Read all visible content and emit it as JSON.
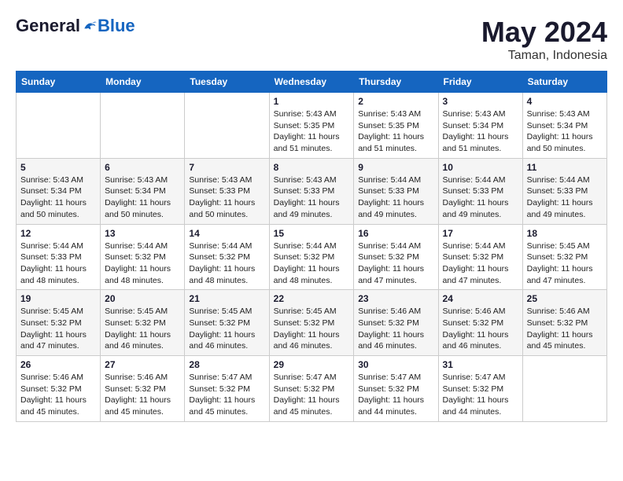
{
  "logo": {
    "general": "General",
    "blue": "Blue"
  },
  "header": {
    "month": "May 2024",
    "location": "Taman, Indonesia"
  },
  "weekdays": [
    "Sunday",
    "Monday",
    "Tuesday",
    "Wednesday",
    "Thursday",
    "Friday",
    "Saturday"
  ],
  "weeks": [
    [
      {
        "day": "",
        "sunrise": "",
        "sunset": "",
        "daylight": ""
      },
      {
        "day": "",
        "sunrise": "",
        "sunset": "",
        "daylight": ""
      },
      {
        "day": "",
        "sunrise": "",
        "sunset": "",
        "daylight": ""
      },
      {
        "day": "1",
        "sunrise": "Sunrise: 5:43 AM",
        "sunset": "Sunset: 5:35 PM",
        "daylight": "Daylight: 11 hours and 51 minutes."
      },
      {
        "day": "2",
        "sunrise": "Sunrise: 5:43 AM",
        "sunset": "Sunset: 5:35 PM",
        "daylight": "Daylight: 11 hours and 51 minutes."
      },
      {
        "day": "3",
        "sunrise": "Sunrise: 5:43 AM",
        "sunset": "Sunset: 5:34 PM",
        "daylight": "Daylight: 11 hours and 51 minutes."
      },
      {
        "day": "4",
        "sunrise": "Sunrise: 5:43 AM",
        "sunset": "Sunset: 5:34 PM",
        "daylight": "Daylight: 11 hours and 50 minutes."
      }
    ],
    [
      {
        "day": "5",
        "sunrise": "Sunrise: 5:43 AM",
        "sunset": "Sunset: 5:34 PM",
        "daylight": "Daylight: 11 hours and 50 minutes."
      },
      {
        "day": "6",
        "sunrise": "Sunrise: 5:43 AM",
        "sunset": "Sunset: 5:34 PM",
        "daylight": "Daylight: 11 hours and 50 minutes."
      },
      {
        "day": "7",
        "sunrise": "Sunrise: 5:43 AM",
        "sunset": "Sunset: 5:33 PM",
        "daylight": "Daylight: 11 hours and 50 minutes."
      },
      {
        "day": "8",
        "sunrise": "Sunrise: 5:43 AM",
        "sunset": "Sunset: 5:33 PM",
        "daylight": "Daylight: 11 hours and 49 minutes."
      },
      {
        "day": "9",
        "sunrise": "Sunrise: 5:44 AM",
        "sunset": "Sunset: 5:33 PM",
        "daylight": "Daylight: 11 hours and 49 minutes."
      },
      {
        "day": "10",
        "sunrise": "Sunrise: 5:44 AM",
        "sunset": "Sunset: 5:33 PM",
        "daylight": "Daylight: 11 hours and 49 minutes."
      },
      {
        "day": "11",
        "sunrise": "Sunrise: 5:44 AM",
        "sunset": "Sunset: 5:33 PM",
        "daylight": "Daylight: 11 hours and 49 minutes."
      }
    ],
    [
      {
        "day": "12",
        "sunrise": "Sunrise: 5:44 AM",
        "sunset": "Sunset: 5:33 PM",
        "daylight": "Daylight: 11 hours and 48 minutes."
      },
      {
        "day": "13",
        "sunrise": "Sunrise: 5:44 AM",
        "sunset": "Sunset: 5:32 PM",
        "daylight": "Daylight: 11 hours and 48 minutes."
      },
      {
        "day": "14",
        "sunrise": "Sunrise: 5:44 AM",
        "sunset": "Sunset: 5:32 PM",
        "daylight": "Daylight: 11 hours and 48 minutes."
      },
      {
        "day": "15",
        "sunrise": "Sunrise: 5:44 AM",
        "sunset": "Sunset: 5:32 PM",
        "daylight": "Daylight: 11 hours and 48 minutes."
      },
      {
        "day": "16",
        "sunrise": "Sunrise: 5:44 AM",
        "sunset": "Sunset: 5:32 PM",
        "daylight": "Daylight: 11 hours and 47 minutes."
      },
      {
        "day": "17",
        "sunrise": "Sunrise: 5:44 AM",
        "sunset": "Sunset: 5:32 PM",
        "daylight": "Daylight: 11 hours and 47 minutes."
      },
      {
        "day": "18",
        "sunrise": "Sunrise: 5:45 AM",
        "sunset": "Sunset: 5:32 PM",
        "daylight": "Daylight: 11 hours and 47 minutes."
      }
    ],
    [
      {
        "day": "19",
        "sunrise": "Sunrise: 5:45 AM",
        "sunset": "Sunset: 5:32 PM",
        "daylight": "Daylight: 11 hours and 47 minutes."
      },
      {
        "day": "20",
        "sunrise": "Sunrise: 5:45 AM",
        "sunset": "Sunset: 5:32 PM",
        "daylight": "Daylight: 11 hours and 46 minutes."
      },
      {
        "day": "21",
        "sunrise": "Sunrise: 5:45 AM",
        "sunset": "Sunset: 5:32 PM",
        "daylight": "Daylight: 11 hours and 46 minutes."
      },
      {
        "day": "22",
        "sunrise": "Sunrise: 5:45 AM",
        "sunset": "Sunset: 5:32 PM",
        "daylight": "Daylight: 11 hours and 46 minutes."
      },
      {
        "day": "23",
        "sunrise": "Sunrise: 5:46 AM",
        "sunset": "Sunset: 5:32 PM",
        "daylight": "Daylight: 11 hours and 46 minutes."
      },
      {
        "day": "24",
        "sunrise": "Sunrise: 5:46 AM",
        "sunset": "Sunset: 5:32 PM",
        "daylight": "Daylight: 11 hours and 46 minutes."
      },
      {
        "day": "25",
        "sunrise": "Sunrise: 5:46 AM",
        "sunset": "Sunset: 5:32 PM",
        "daylight": "Daylight: 11 hours and 45 minutes."
      }
    ],
    [
      {
        "day": "26",
        "sunrise": "Sunrise: 5:46 AM",
        "sunset": "Sunset: 5:32 PM",
        "daylight": "Daylight: 11 hours and 45 minutes."
      },
      {
        "day": "27",
        "sunrise": "Sunrise: 5:46 AM",
        "sunset": "Sunset: 5:32 PM",
        "daylight": "Daylight: 11 hours and 45 minutes."
      },
      {
        "day": "28",
        "sunrise": "Sunrise: 5:47 AM",
        "sunset": "Sunset: 5:32 PM",
        "daylight": "Daylight: 11 hours and 45 minutes."
      },
      {
        "day": "29",
        "sunrise": "Sunrise: 5:47 AM",
        "sunset": "Sunset: 5:32 PM",
        "daylight": "Daylight: 11 hours and 45 minutes."
      },
      {
        "day": "30",
        "sunrise": "Sunrise: 5:47 AM",
        "sunset": "Sunset: 5:32 PM",
        "daylight": "Daylight: 11 hours and 44 minutes."
      },
      {
        "day": "31",
        "sunrise": "Sunrise: 5:47 AM",
        "sunset": "Sunset: 5:32 PM",
        "daylight": "Daylight: 11 hours and 44 minutes."
      },
      {
        "day": "",
        "sunrise": "",
        "sunset": "",
        "daylight": ""
      }
    ]
  ]
}
